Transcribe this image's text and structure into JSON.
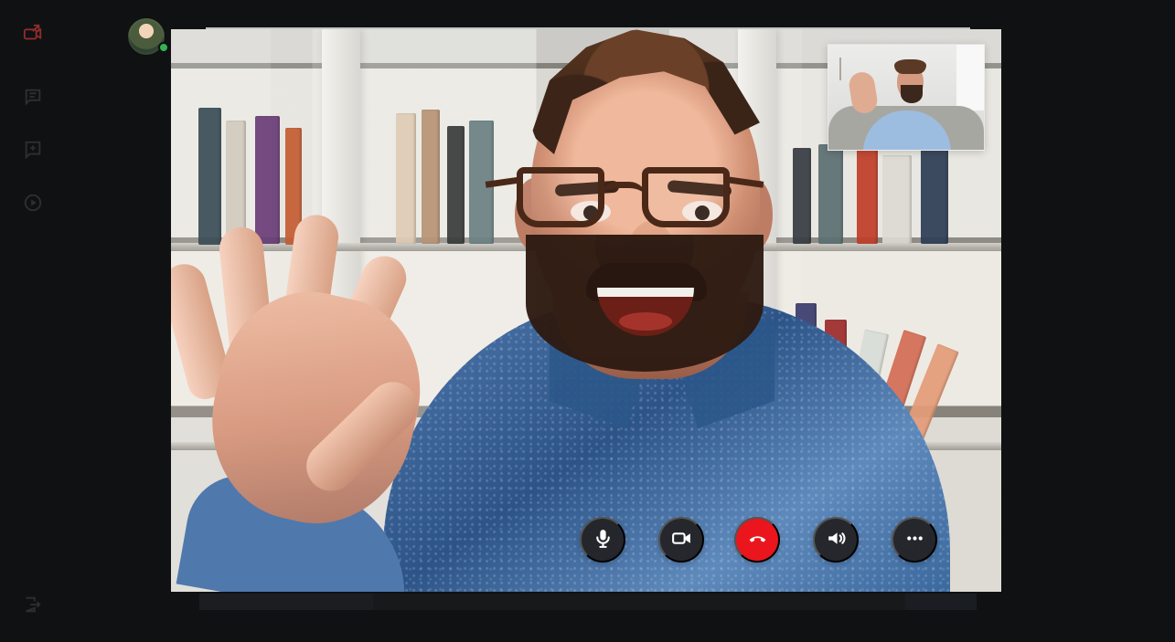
{
  "sidebar": {
    "items": [
      {
        "icon": "video-chat-icon",
        "accent": "#c7352f"
      },
      {
        "icon": "chat-icon"
      },
      {
        "icon": "add-chat-icon"
      },
      {
        "icon": "play-circle-icon"
      },
      {
        "icon": "exit-icon"
      }
    ]
  },
  "call": {
    "self_view": {
      "icon": "self-view-video"
    },
    "controls": [
      {
        "name": "microphone-button",
        "icon": "microphone-icon"
      },
      {
        "name": "video-button",
        "icon": "video-camera-icon"
      },
      {
        "name": "end-call-button",
        "icon": "phone-hangup-icon",
        "color": "#ea151d"
      },
      {
        "name": "speaker-button",
        "icon": "speaker-icon"
      },
      {
        "name": "more-options-button",
        "icon": "more-icon"
      }
    ]
  },
  "status": {
    "online_color": "#34b356"
  }
}
